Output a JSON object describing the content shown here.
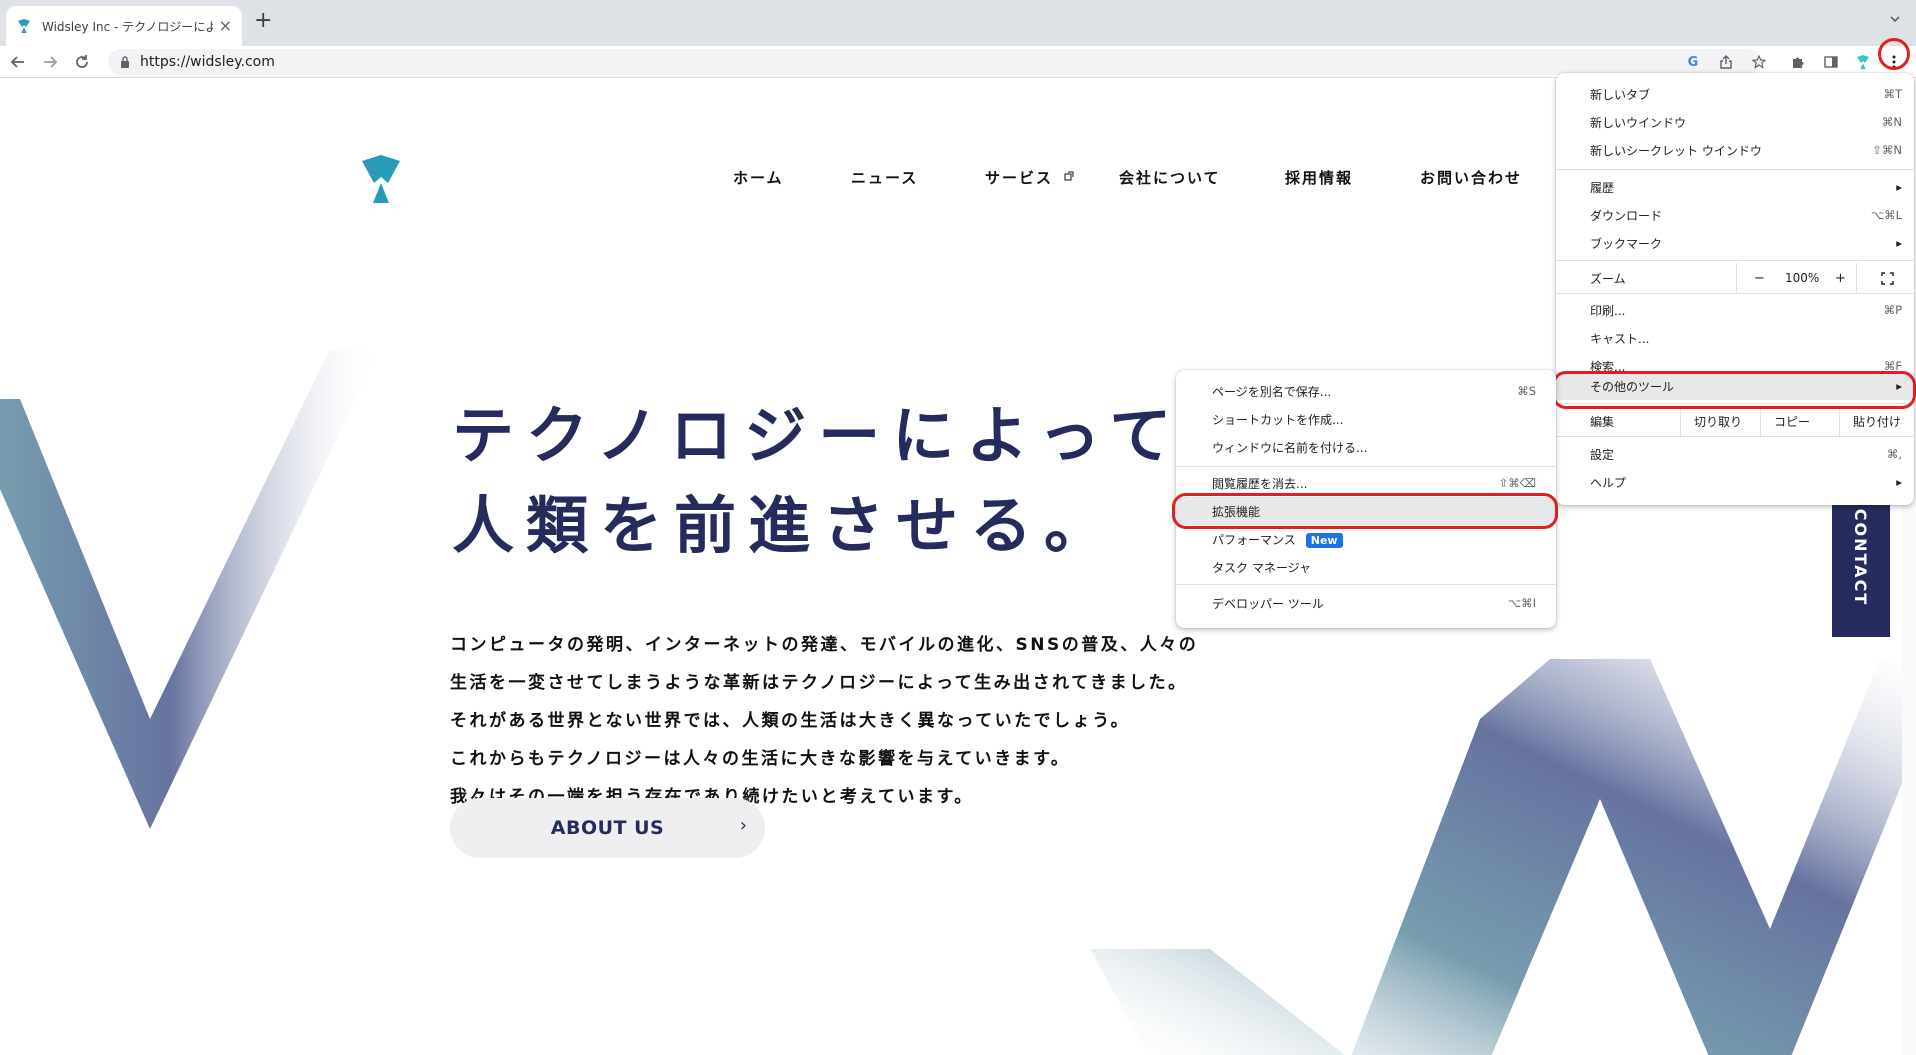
{
  "browser": {
    "tab_title": "Widsley Inc - テクノロジーによっ",
    "tab_close": "×",
    "new_tab": "+",
    "url": "https://widsley.com"
  },
  "site": {
    "nav": [
      "ホーム",
      "ニュース",
      "サービス",
      "会社について",
      "採用情報",
      "お問い合わせ"
    ],
    "headline_line1": "テクノロジーによって",
    "headline_line2": "人類を前進させる。",
    "paragraph": [
      "コンピュータの発明、インターネットの発達、モバイルの進化、SNSの普及、人々の",
      "生活を一変させてしまうような革新はテクノロジーによって生み出されてきました。",
      "それがある世界とない世界では、人類の生活は大きく異なっていたでしょう。",
      "これからもテクノロジーは人々の生活に大きな影響を与えていきます。",
      "我々はその一端を担う存在であり続けたいと考えています。"
    ],
    "about_button": "ABOUT US",
    "about_chevron": "›",
    "contact_tab": "CONTACT",
    "accent_color": "#252b5c",
    "logo_color": "#2a9ab9"
  },
  "chrome_menu": {
    "new_tab": {
      "label": "新しいタブ",
      "shortcut": "⌘T"
    },
    "new_window": {
      "label": "新しいウインドウ",
      "shortcut": "⌘N"
    },
    "new_incognito": {
      "label": "新しいシークレット ウインドウ",
      "shortcut": "⇧⌘N"
    },
    "history": {
      "label": "履歴"
    },
    "downloads": {
      "label": "ダウンロード",
      "shortcut": "⌥⌘L"
    },
    "bookmarks": {
      "label": "ブックマーク"
    },
    "zoom": {
      "label": "ズーム",
      "minus": "−",
      "value": "100%",
      "plus": "+"
    },
    "print": {
      "label": "印刷...",
      "shortcut": "⌘P"
    },
    "cast": {
      "label": "キャスト..."
    },
    "find": {
      "label": "検索...",
      "shortcut": "⌘F"
    },
    "more_tools": {
      "label": "その他のツール"
    },
    "edit": {
      "label": "編集",
      "cut": "切り取り",
      "copy": "コピー",
      "paste": "貼り付け"
    },
    "settings": {
      "label": "設定",
      "shortcut": "⌘,"
    },
    "help": {
      "label": "ヘルプ"
    },
    "submenu_arrow": "▸"
  },
  "more_tools_menu": {
    "save_page": {
      "label": "ページを別名で保存...",
      "shortcut": "⌘S"
    },
    "create_shortcut": {
      "label": "ショートカットを作成..."
    },
    "name_window": {
      "label": "ウィンドウに名前を付ける..."
    },
    "clear_data": {
      "label": "閲覧履歴を消去...",
      "shortcut": "⇧⌘⌫"
    },
    "extensions": {
      "label": "拡張機能"
    },
    "performance": {
      "label": "パフォーマンス",
      "badge": "New"
    },
    "task_manager": {
      "label": "タスク マネージャ"
    },
    "dev_tools": {
      "label": "デベロッパー ツール",
      "shortcut": "⌥⌘I"
    }
  }
}
